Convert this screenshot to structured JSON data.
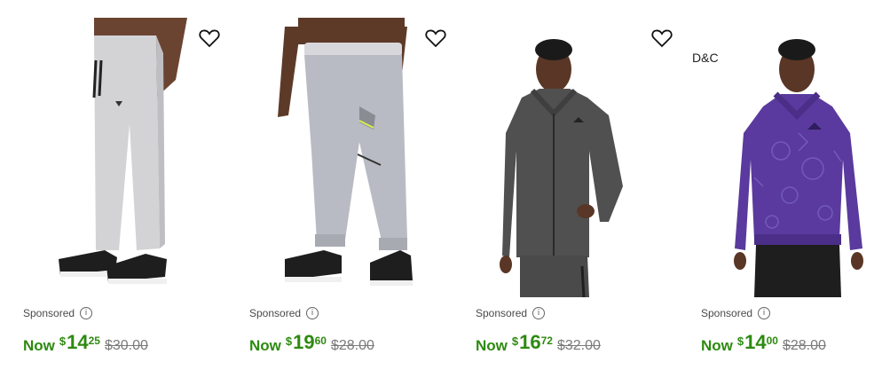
{
  "products": [
    {
      "image_alt": "Reebok men's gray jogger pants with black sneakers",
      "wishlist_icon": "heart-outline-icon",
      "sponsored_label": "Sponsored",
      "info_icon": "info-icon",
      "now_label": "Now",
      "currency": "$",
      "price_dollars": "14",
      "price_cents": "25",
      "original_price": "$30.00"
    },
    {
      "image_alt": "Reebok men's light gray cargo jogger pants with black sneakers",
      "wishlist_icon": "heart-outline-icon",
      "sponsored_label": "Sponsored",
      "info_icon": "info-icon",
      "now_label": "Now",
      "currency": "$",
      "price_dollars": "19",
      "price_cents": "60",
      "original_price": "$28.00"
    },
    {
      "image_alt": "Reebok men's charcoal gray full-zip hoodie",
      "wishlist_icon": "heart-outline-icon",
      "sponsored_label": "Sponsored",
      "info_icon": "info-icon",
      "now_label": "Now",
      "currency": "$",
      "price_dollars": "16",
      "price_cents": "72",
      "original_price": "$32.00"
    },
    {
      "brand_text": "D&C",
      "image_alt": "Reebok men's purple printed pullover hoodie",
      "sponsored_label": "Sponsored",
      "info_icon": "info-icon",
      "now_label": "Now",
      "currency": "$",
      "price_dollars": "14",
      "price_cents": "00",
      "original_price": "$28.00"
    }
  ],
  "colors": {
    "sale_green": "#2d8a10",
    "strike_gray": "#7a7a7a",
    "hoodie_purple": "#5a3a9e",
    "hoodie_charcoal": "#505050",
    "pants_gray": "#c8c8cc"
  }
}
